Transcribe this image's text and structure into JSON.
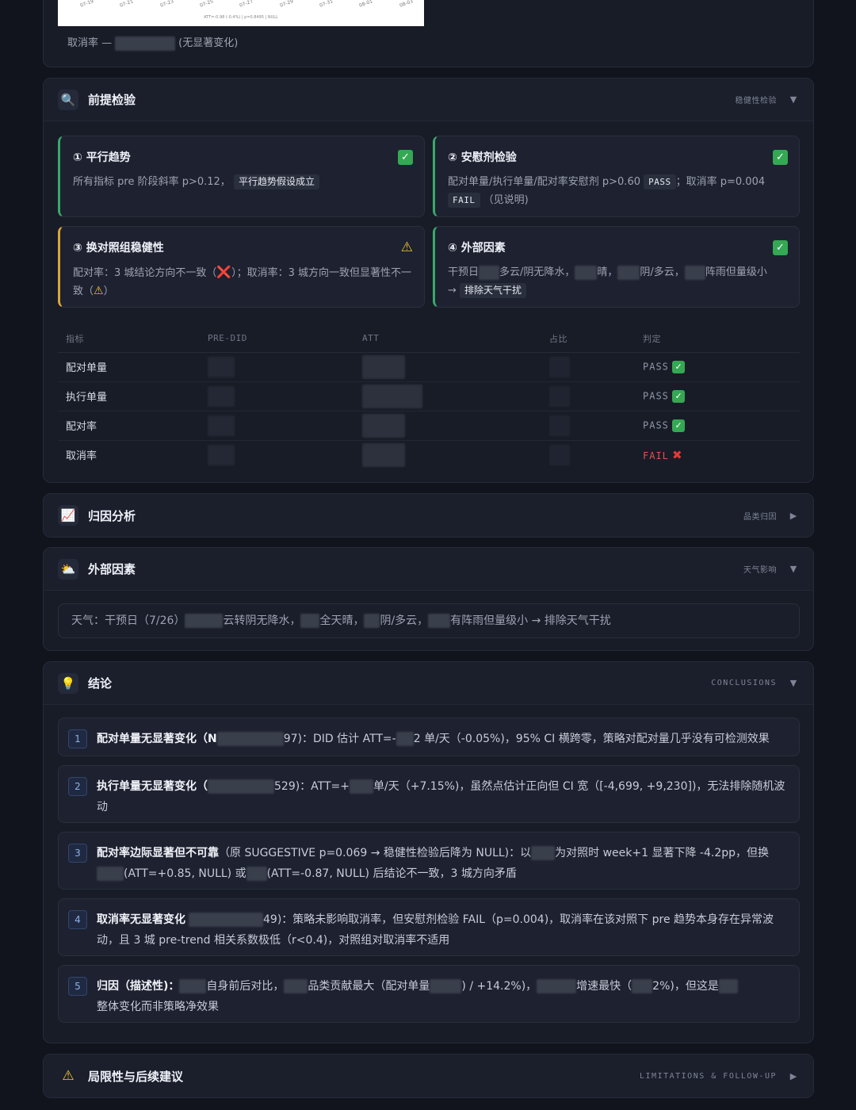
{
  "top": {
    "chart_ticks": [
      "07-19",
      "07-21",
      "07-23",
      "07-25",
      "07-27",
      "07-29",
      "07-31",
      "08-01",
      "08-03"
    ],
    "chart_note": "ATT=-0.98 (-0.4%) | p=0.8495 | NULL",
    "caption_prefix": "取消率 —",
    "caption_suffix": "(无显著变化)"
  },
  "premise": {
    "icon": "magnifier-icon",
    "title": "前提检验",
    "tag": "稳健性检验",
    "cards": [
      {
        "title": "① 平行趋势",
        "status": "pass",
        "text": "所有指标 pre 阶段斜率 p>0.12，",
        "pill": "平行趋势假设成立"
      },
      {
        "title": "② 安慰剂检验",
        "status": "pass",
        "text1": "配对单量/执行单量/配对率安慰剂 p>0.60",
        "pill1": "PASS",
        "text2": "；取消率 p=0.004",
        "pill2": "FAIL",
        "text3": "（见说明)"
      },
      {
        "title": "③ 换对照组稳健性",
        "status": "warn",
        "text1": "配对率：3 城结论方向不一致（",
        "text2": "）；取消率：3 城方向一致但显著性不一致（",
        "text3": "）"
      },
      {
        "title": "④ 外部因素",
        "status": "pass",
        "text1": "干预日",
        "text2": "多云/阴无降水，",
        "text3": "晴，",
        "text4": "阴/多云，",
        "text5": "阵雨但量级小",
        "text6": "→",
        "pill": "排除天气干扰"
      }
    ],
    "table": {
      "headers": [
        "指标",
        "PRE-DID",
        "ATT",
        "占比",
        "判定"
      ],
      "rows": [
        {
          "metric": "配对单量",
          "verdict": "PASS",
          "ok": true
        },
        {
          "metric": "执行单量",
          "verdict": "PASS",
          "ok": true
        },
        {
          "metric": "配对率",
          "verdict": "PASS",
          "ok": true
        },
        {
          "metric": "取消率",
          "verdict": "FAIL",
          "ok": false
        }
      ]
    }
  },
  "attribution": {
    "icon": "chart-icon",
    "title": "归因分析",
    "tag": "品类归因"
  },
  "external": {
    "icon": "weather-icon",
    "title": "外部因素",
    "tag": "天气影响",
    "p1": "天气：干预日（7/26）",
    "p2": "云转阴无降水，",
    "p3": "全天晴，",
    "p4": "阴/多云，",
    "p5": "有阵雨但量级小 → 排除天气干扰"
  },
  "conclusions": {
    "icon": "lightbulb-icon",
    "title": "结论",
    "tag": "CONCLUSIONS",
    "items": [
      {
        "num": "1",
        "bold": "配对单量无显著变化（N",
        "t1": "97)：DID 估计 ATT=-",
        "t2": "2 单/天（-0.05%)，95% CI 横跨零，策略对配对量几乎没有可检测效果"
      },
      {
        "num": "2",
        "bold": "执行单量无显著变化（",
        "t1": "529)：ATT=+",
        "t2": "单/天（+7.15%)，虽然点估计正向但 CI 宽（[-4,699, +9,230])，无法排除随机波动"
      },
      {
        "num": "3",
        "bold": "配对率边际显著但不可靠",
        "t1": "（原 SUGGESTIVE p=0.069 → 稳健性检验后降为 NULL)：以",
        "t2": "为对照时 week+1 显著下降 -4.2pp，但换",
        "t3": "(ATT=+0.85, NULL) 或",
        "t4": "(ATT=-0.87, NULL) 后结论不一致，3 城方向矛盾"
      },
      {
        "num": "4",
        "bold": "取消率无显著变化",
        "t1": "49)：策略未影响取消率，但安慰剂检验 FAIL（p=0.004)，取消率在该对照下 pre 趋势本身存在异常波动，且 3 城 pre-trend 相关系数极低（r<0.4)，对照组对取消率不适用"
      },
      {
        "num": "5",
        "bold": "归因（描述性)：",
        "t1": "自身前后对比，",
        "t2": "品类贡献最大（配对单量",
        "t3": ") / +14.2%)，",
        "t4": "增速最快（",
        "t5": "2%)，但这是",
        "t6": "整体变化而非策略净效果"
      }
    ]
  },
  "limitations": {
    "icon": "warning-icon",
    "title": "局限性与后续建议",
    "tag": "LIMITATIONS & FOLLOW-UP"
  }
}
